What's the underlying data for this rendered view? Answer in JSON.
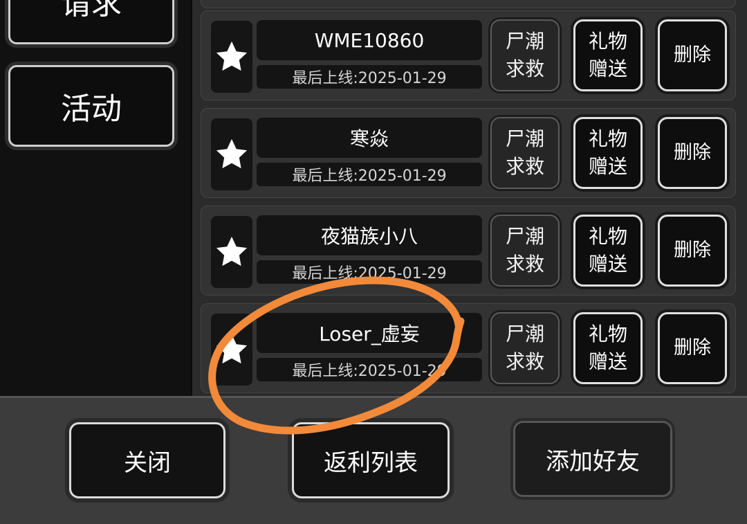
{
  "sidebar": {
    "items": [
      {
        "label": "请求"
      },
      {
        "label": "活动"
      }
    ]
  },
  "friends": {
    "rows": [
      {
        "name": "WME10860",
        "last_online": "最后上线:2025-01-29",
        "rescue_line1": "尸潮",
        "rescue_line2": "求救",
        "gift_line1": "礼物",
        "gift_line2": "赠送",
        "delete_label": "删除"
      },
      {
        "name": "寒焱",
        "last_online": "最后上线:2025-01-29",
        "rescue_line1": "尸潮",
        "rescue_line2": "求救",
        "gift_line1": "礼物",
        "gift_line2": "赠送",
        "delete_label": "删除"
      },
      {
        "name": "夜猫族小八",
        "last_online": "最后上线:2025-01-29",
        "rescue_line1": "尸潮",
        "rescue_line2": "求救",
        "gift_line1": "礼物",
        "gift_line2": "赠送",
        "delete_label": "删除"
      },
      {
        "name": "Loser_虚妄",
        "last_online": "最后上线:2025-01-29",
        "rescue_line1": "尸潮",
        "rescue_line2": "求救",
        "gift_line1": "礼物",
        "gift_line2": "赠送",
        "delete_label": "删除"
      }
    ]
  },
  "bottom_bar": {
    "close_label": "关闭",
    "rebate_list_label": "返利列表",
    "add_friend_label": "添加好友"
  },
  "icons": {
    "favorite": "star-icon"
  },
  "colors": {
    "annotation": "#f28a3a",
    "panel_bg": "#2b2b2b",
    "button_border": "#e0e0e0"
  }
}
